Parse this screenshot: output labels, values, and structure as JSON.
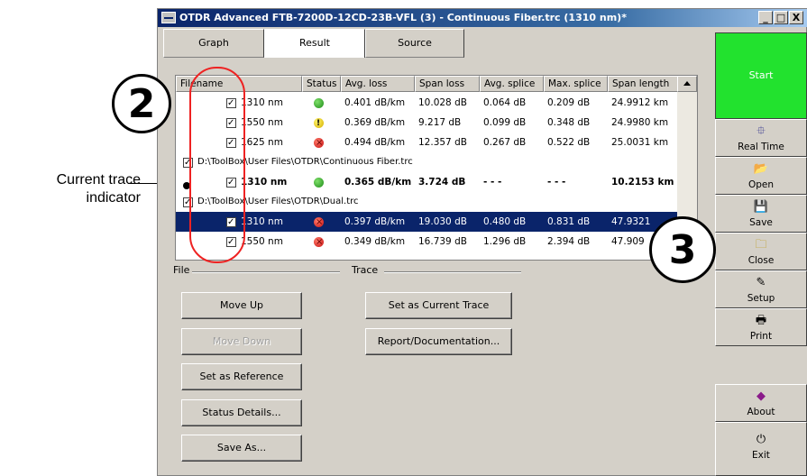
{
  "annotations": {
    "current_trace_label": "Current trace indicator",
    "callout_2": "2",
    "callout_3": "3"
  },
  "window": {
    "title": "OTDR Advanced FTB-7200D-12CD-23B-VFL (3) - Continuous Fiber.trc (1310 nm)*",
    "minimize": "_",
    "maximize": "□",
    "close": "X"
  },
  "tabs": [
    {
      "label": "Graph",
      "active": false
    },
    {
      "label": "Result",
      "active": true
    },
    {
      "label": "Source",
      "active": false
    }
  ],
  "table": {
    "columns": [
      "Filename",
      "Status",
      "Avg. loss",
      "Span loss",
      "Avg. splice",
      "Max. splice",
      "Span length"
    ],
    "rows": [
      {
        "type": "trace",
        "checked": true,
        "name": "1310 nm",
        "status": "ok",
        "avg_loss": "0.401 dB/km",
        "span_loss": "10.028 dB",
        "avg_splice": "0.064 dB",
        "max_splice": "0.209 dB",
        "span_length": "24.9912 km"
      },
      {
        "type": "trace",
        "checked": true,
        "name": "1550 nm",
        "status": "warn",
        "avg_loss": "0.369 dB/km",
        "span_loss": "9.217 dB",
        "avg_splice": "0.099 dB",
        "max_splice": "0.348 dB",
        "span_length": "24.9980 km"
      },
      {
        "type": "trace",
        "checked": true,
        "name": "1625 nm",
        "status": "fail",
        "avg_loss": "0.494 dB/km",
        "span_loss": "12.357 dB",
        "avg_splice": "0.267 dB",
        "max_splice": "0.522 dB",
        "span_length": "25.0031 km"
      },
      {
        "type": "file",
        "checked": true,
        "name": "D:\\ToolBox\\User Files\\OTDR\\Continuous Fiber.trc"
      },
      {
        "type": "trace",
        "checked": true,
        "current": true,
        "bold": true,
        "name": "1310 nm",
        "status": "ok",
        "avg_loss": "0.365 dB/km",
        "span_loss": "3.724 dB",
        "avg_splice": "- - -",
        "max_splice": "- - -",
        "span_length": "10.2153 km"
      },
      {
        "type": "file",
        "checked": true,
        "name": "D:\\ToolBox\\User Files\\OTDR\\Dual.trc"
      },
      {
        "type": "trace",
        "checked": true,
        "selected": true,
        "name": "1310 nm",
        "status": "fail",
        "avg_loss": "0.397 dB/km",
        "span_loss": "19.030 dB",
        "avg_splice": "0.480 dB",
        "max_splice": "0.831 dB",
        "span_length": "47.9321"
      },
      {
        "type": "trace",
        "checked": true,
        "name": "1550 nm",
        "status": "fail",
        "avg_loss": "0.349 dB/km",
        "span_loss": "16.739 dB",
        "avg_splice": "1.296 dB",
        "max_splice": "2.394 dB",
        "span_length": "47.909"
      }
    ]
  },
  "file_group": {
    "label": "File",
    "buttons": [
      {
        "label": "Move Up",
        "enabled": true
      },
      {
        "label": "Move Down",
        "enabled": false
      },
      {
        "label": "Set as Reference",
        "enabled": true
      },
      {
        "label": "Status Details...",
        "enabled": true
      },
      {
        "label": "Save As...",
        "enabled": true
      }
    ]
  },
  "trace_group": {
    "label": "Trace",
    "buttons": [
      {
        "label": "Set as Current Trace",
        "enabled": true
      },
      {
        "label": "Report/Documentation...",
        "enabled": true
      }
    ]
  },
  "sidebar": {
    "start": "Start",
    "items": [
      {
        "label": "Real Time",
        "icon": "realtime-icon",
        "glyph": "⯐"
      },
      {
        "label": "Open",
        "icon": "open-icon",
        "glyph": "📂"
      },
      {
        "label": "Save",
        "icon": "save-icon",
        "glyph": "💾"
      },
      {
        "label": "Close",
        "icon": "folder-icon",
        "glyph": "🗀"
      },
      {
        "label": "Setup",
        "icon": "setup-icon",
        "glyph": "✎"
      },
      {
        "label": "Print",
        "icon": "print-icon",
        "glyph": "🖶"
      },
      {
        "label": "About",
        "icon": "about-icon",
        "glyph": "◆"
      },
      {
        "label": "Exit",
        "icon": "exit-icon",
        "glyph": "⏻"
      }
    ]
  },
  "colors": {
    "start_green": "#22e22e",
    "selection_blue": "#0a246a",
    "callout_red": "#e22222"
  }
}
